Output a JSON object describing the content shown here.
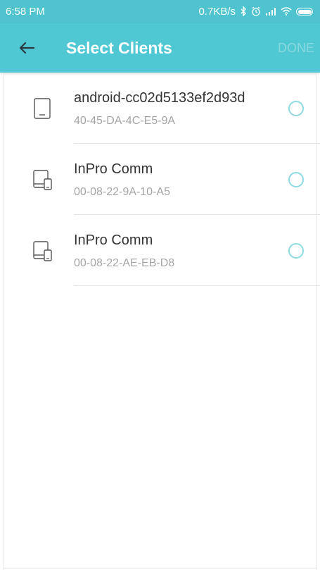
{
  "status_bar": {
    "time": "6:58 PM",
    "speed": "0.7KB/s",
    "icons": [
      "bluetooth-icon",
      "alarm-icon",
      "signal-icon",
      "wifi-icon",
      "battery-icon"
    ]
  },
  "app_bar": {
    "back_icon": "arrow-left-icon",
    "title": "Select Clients",
    "done_label": "DONE"
  },
  "clients": [
    {
      "name": "android-cc02d5133ef2d93d",
      "mac": "40-45-DA-4C-E5-9A",
      "icon": "tablet-icon",
      "selected": false
    },
    {
      "name": "InPro Comm",
      "mac": "00-08-22-9A-10-A5",
      "icon": "multi-device-icon",
      "selected": false
    },
    {
      "name": "InPro Comm",
      "mac": "00-08-22-AE-EB-D8",
      "icon": "multi-device-icon",
      "selected": false
    }
  ],
  "colors": {
    "accent": "#4fc8d4",
    "status_bar": "#4fc3cf",
    "done_disabled": "#8ad8df",
    "radio": "#8fd9e1",
    "primary_text": "#333333",
    "secondary_text": "#a5a5a5"
  }
}
